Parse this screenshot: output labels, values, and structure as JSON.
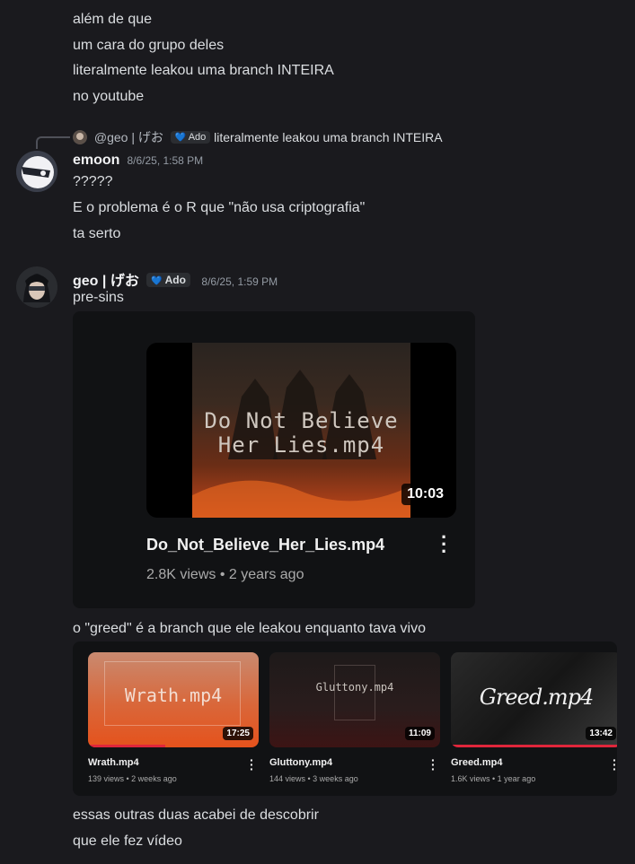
{
  "top_lines": [
    "além de que",
    "um cara do grupo deles",
    "literalmente leakou uma branch INTEIRA",
    "no youtube"
  ],
  "reply": {
    "username": "@geo | げお",
    "tag": "Ado",
    "text": "literalmente leakou uma branch INTEIRA"
  },
  "message1": {
    "username": "emoon",
    "timestamp": "8/6/25, 1:58 PM",
    "lines": [
      "?????",
      "E o problema é o R que \"não usa criptografia\"",
      "ta serto"
    ]
  },
  "message2": {
    "username": "geo | げお",
    "tag": "Ado",
    "timestamp": "8/6/25, 1:59 PM",
    "text": "pre-sins",
    "video": {
      "thumb_text_line1": "Do Not Believe",
      "thumb_text_line2": "Her Lies.mp4",
      "duration": "10:03",
      "title": "Do_Not_Believe_Her_Lies.mp4",
      "meta": "2.8K views • 2 years ago"
    },
    "text2": "o \"greed\" é a branch que ele leakou enquanto tava vivo",
    "videos": [
      {
        "thumb_text": "Wrath.mp4",
        "duration": "17:25",
        "title": "Wrath.mp4",
        "meta": "139 views • 2 weeks ago",
        "progress": 0.45
      },
      {
        "thumb_text": "Gluttony.mp4",
        "duration": "11:09",
        "title": "Gluttony.mp4",
        "meta": "144 views • 3 weeks ago",
        "progress": 0
      },
      {
        "thumb_text": "Greed.mp4",
        "duration": "13:42",
        "title": "Greed.mp4",
        "meta": "1.6K views • 1 year ago",
        "progress": 1.0
      }
    ],
    "bottom_lines": [
      "essas outras duas acabei de descobrir",
      "que ele fez vídeo"
    ]
  },
  "colors": {
    "background": "#1a1a1e",
    "text": "#dbdee1",
    "muted": "#949ba4",
    "progress": "#e0263b"
  }
}
